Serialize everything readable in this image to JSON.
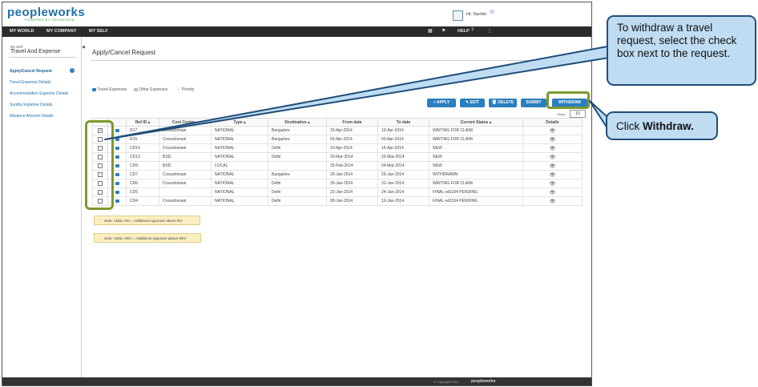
{
  "header": {
    "logo": "peopleworks",
    "logo_tagline": "POWERED BY ADVANTAGE",
    "user_greeting": "Hi, Sachin"
  },
  "nav": {
    "items": [
      "MY WORLD",
      "MY COMPANY",
      "MY SELF"
    ],
    "help": "HELP"
  },
  "sidebar": {
    "crumb": "My Self",
    "title": "Travel And Expense",
    "items": [
      {
        "label": "Apply/Cancel Request",
        "active": true
      },
      {
        "label": "Travel Expense Details"
      },
      {
        "label": "Accommodation Expense Details"
      },
      {
        "label": "Sundry Expense Details"
      },
      {
        "label": "Advance Amount Details"
      }
    ]
  },
  "main": {
    "title": "Apply/Cancel Request",
    "legend": {
      "travel": "Travel Expenses",
      "other": "Other Expenses",
      "priority": "Priority"
    },
    "buttons": {
      "apply": "+ APPLY",
      "edit": "EDIT",
      "delete": "DELETE",
      "submit": "SUBMIT",
      "withdraw": "WITHDRAW"
    },
    "show_label": "Show",
    "show_value": "10",
    "columns": [
      "Ref ID",
      "Cost Center",
      "Type",
      "Destination",
      "From date",
      "To date",
      "Current Status",
      "Details"
    ],
    "rows": [
      {
        "checked": true,
        "ref": "R17",
        "cost": "Crossdomain",
        "type": "NATIONAL",
        "dest": "Bangalore",
        "from": "10-Apr-2014",
        "to": "10-Apr-2014",
        "status": "WAITING FOR CLAIM"
      },
      {
        "checked": false,
        "ref": "R15",
        "cost": "Crossdomain",
        "type": "NATIONAL",
        "dest": "Bangalore",
        "from": "03-Apr-2014",
        "to": "03-Apr-2014",
        "status": "WAITING FOR CLAIM"
      },
      {
        "checked": false,
        "ref": "CD14",
        "cost": "Crossdomain",
        "type": "NATIONAL",
        "dest": "Delhi",
        "from": "10-Apr-2014",
        "to": "15-Apr-2014",
        "status": "NEW"
      },
      {
        "checked": false,
        "ref": "CD13",
        "cost": "BSD",
        "type": "NATIONAL",
        "dest": "Delhi",
        "from": "20-Mar-2014",
        "to": "22-Mar-2014",
        "status": "NEW"
      },
      {
        "checked": false,
        "ref": "CD9",
        "cost": "BSD",
        "type": "LOCAL",
        "dest": "",
        "from": "25-Feb-2014",
        "to": "04-Mar-2014",
        "status": "NEW"
      },
      {
        "checked": false,
        "ref": "CD7",
        "cost": "Crossdomain",
        "type": "NATIONAL",
        "dest": "Bangalore",
        "from": "29-Jan-2014",
        "to": "29-Jan-2014",
        "status": "WITHDRAWN"
      },
      {
        "checked": false,
        "ref": "CD6",
        "cost": "Crossdomain",
        "type": "NATIONAL",
        "dest": "Delhi",
        "from": "30-Jan-2014",
        "to": "31-Jan-2014",
        "status": "WAITING FOR CLAIM"
      },
      {
        "checked": false,
        "ref": "CD5",
        "cost": "",
        "type": "NATIONAL",
        "dest": "Delhi",
        "from": "23-Jan-2014",
        "to": "24-Jan-2014",
        "status": "FINAL-xd1194 PENDING"
      },
      {
        "checked": false,
        "ref": "CD4",
        "cost": "Crossdomain",
        "type": "NATIONAL",
        "dest": "Delhi",
        "from": "09-Jan-2014",
        "to": "10-Jan-2014",
        "status": "FINAL-xd1194 PENDING"
      }
    ],
    "notes": [
      "Note: ADDL-RO = Additional Approver above RO",
      "Note: ADDL-REV = Additional Approver above REV"
    ]
  },
  "footer": {
    "copy": "© Copyright 2014",
    "logo": "peopleworks"
  },
  "callouts": {
    "withdraw_instruction": "To withdraw a travel request, select the check box next to the request.",
    "click_prefix": "Click ",
    "click_bold": "Withdraw."
  },
  "colors": {
    "accent": "#2a7fc0",
    "highlight": "#7c9a2e",
    "callout_fill": "#bfdcf2",
    "callout_border": "#1f4e79"
  }
}
